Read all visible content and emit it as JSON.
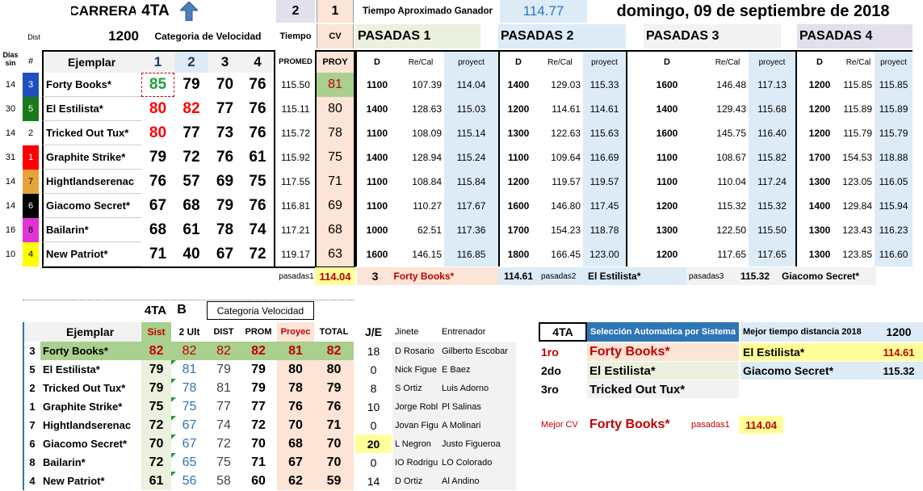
{
  "header": {
    "carrera": "CARRERA",
    "race": "4TA",
    "n2": "2",
    "n1": "1",
    "tiempo_label": "Tiempo Aproximado Ganador",
    "tiempo_value": "114.77",
    "date": "domingo, 09 de septiembre de 2018",
    "dist_label": "Dist",
    "dist_value": "1200",
    "cat_label": "Categoria de Velocidad",
    "tiempo_col": "Tiempo",
    "cv": "CV",
    "pasadas1": "PASADAS 1",
    "pasadas2": "PASADAS 2",
    "pasadas3": "PASADAS 3",
    "pasadas4": "PASADAS 4"
  },
  "cols": {
    "dias": "Dias sin",
    "num": "#",
    "ejemplar": "Ejemplar",
    "c1": "1",
    "c2": "2",
    "c3": "3",
    "c4": "4",
    "promed": "PROMED",
    "proy": "PROY",
    "d": "D",
    "recal": "Re/Cal",
    "proyect": "proyect"
  },
  "colors": {
    "post1": "#1f4fbf",
    "post2": "#1a7a1a",
    "post3": "#ffffff",
    "post4": "#ff0000",
    "post5": "#000000",
    "post6": "#e6a33a",
    "post7": "#e233d6",
    "post8": "#ffff00",
    "arrow": "#4a7ebb",
    "hl_green": "#a9d08e",
    "hl_yellow": "#ffff99",
    "accent_blue": "#2e75b6"
  },
  "rows": [
    {
      "dias": "14",
      "post": "3",
      "name": "Forty Books*",
      "s1": "85",
      "s2": "79",
      "s3": "70",
      "s4": "76",
      "prom": "115.50",
      "proy": "81",
      "p1d": "1100",
      "p1r": "107.39",
      "p1p": "114.04",
      "p2d": "1400",
      "p2r": "129.03",
      "p2p": "115.33",
      "p3d": "1600",
      "p3r": "146.48",
      "p3p": "117.13",
      "p4d": "1200",
      "p4r": "115.85",
      "p4p": "115.85"
    },
    {
      "dias": "30",
      "post": "5",
      "name": "El Estilista*",
      "s1": "80",
      "s2": "82",
      "s3": "77",
      "s4": "76",
      "prom": "115.11",
      "proy": "80",
      "p1d": "1400",
      "p1r": "128.63",
      "p1p": "115.03",
      "p2d": "1200",
      "p2r": "114.61",
      "p2p": "114.61",
      "p3d": "1400",
      "p3r": "129.43",
      "p3p": "115.68",
      "p4d": "1200",
      "p4r": "115.89",
      "p4p": "115.89"
    },
    {
      "dias": "14",
      "post": "2",
      "name": "Tricked Out Tux*",
      "s1": "80",
      "s2": "77",
      "s3": "73",
      "s4": "76",
      "prom": "115.72",
      "proy": "78",
      "p1d": "1100",
      "p1r": "108.09",
      "p1p": "115.14",
      "p2d": "1300",
      "p2r": "122.63",
      "p2p": "115.63",
      "p3d": "1600",
      "p3r": "145.75",
      "p3p": "116.40",
      "p4d": "1200",
      "p4r": "115.79",
      "p4p": "115.79"
    },
    {
      "dias": "31",
      "post": "1",
      "name": "Graphite Strike*",
      "s1": "79",
      "s2": "72",
      "s3": "76",
      "s4": "61",
      "prom": "115.92",
      "proy": "75",
      "p1d": "1400",
      "p1r": "128.94",
      "p1p": "115.24",
      "p2d": "1100",
      "p2r": "109.64",
      "p2p": "116.69",
      "p3d": "1100",
      "p3r": "108.67",
      "p3p": "115.82",
      "p4d": "1700",
      "p4r": "154.53",
      "p4p": "118.88"
    },
    {
      "dias": "14",
      "post": "7",
      "name": "Hightlandserenac",
      "s1": "76",
      "s2": "57",
      "s3": "69",
      "s4": "75",
      "prom": "117.55",
      "proy": "71",
      "p1d": "1100",
      "p1r": "108.84",
      "p1p": "115.84",
      "p2d": "1200",
      "p2r": "119.57",
      "p2p": "119.57",
      "p3d": "1100",
      "p3r": "110.04",
      "p3p": "117.24",
      "p4d": "1300",
      "p4r": "123.05",
      "p4p": "116.05"
    },
    {
      "dias": "14",
      "post": "6",
      "name": "Giacomo Secret*",
      "s1": "67",
      "s2": "68",
      "s3": "79",
      "s4": "76",
      "prom": "116.81",
      "proy": "69",
      "p1d": "1100",
      "p1r": "110.27",
      "p1p": "117.67",
      "p2d": "1600",
      "p2r": "146.80",
      "p2p": "117.45",
      "p3d": "1200",
      "p3r": "115.32",
      "p3p": "115.32",
      "p4d": "1400",
      "p4r": "129.84",
      "p4p": "115.94"
    },
    {
      "dias": "16",
      "post": "8",
      "name": "Bailarin*",
      "s1": "68",
      "s2": "61",
      "s3": "78",
      "s4": "74",
      "prom": "117.21",
      "proy": "68",
      "p1d": "1000",
      "p1r": "62.51",
      "p1p": "117.36",
      "p2d": "1700",
      "p2r": "154.23",
      "p2p": "118.78",
      "p3d": "1300",
      "p3r": "122.50",
      "p3p": "115.50",
      "p4d": "1300",
      "p4r": "123.43",
      "p4p": "116.23"
    },
    {
      "dias": "10",
      "post": "4",
      "name": "New Patriot*",
      "s1": "71",
      "s2": "40",
      "s3": "67",
      "s4": "72",
      "prom": "119.17",
      "proy": "63",
      "p1d": "1600",
      "p1r": "146.15",
      "p1p": "116.85",
      "p2d": "1800",
      "p2r": "166.45",
      "p2p": "123.00",
      "p3d": "1200",
      "p3r": "117.65",
      "p3p": "117.65",
      "p4d": "1300",
      "p4r": "123.85",
      "p4p": "116.60"
    }
  ],
  "summary": {
    "pasadas1_label": "pasadas1",
    "pasadas1_val": "114.04",
    "num": "3",
    "horse1": "Forty Books*",
    "val2": "114.61",
    "pasadas2_label": "pasadas2",
    "horse2": "El Estilista*",
    "pasadas3_label": "pasadas3",
    "val3": "115.32",
    "horse3": "Giacomo Secret*"
  },
  "lower": {
    "title": "4TA",
    "b": "B",
    "cat": "Categoria Velocidad",
    "cols": {
      "ejemplar": "Ejemplar",
      "sist": "Sist",
      "ult": "2 Ult",
      "dist": "DIST",
      "prom": "PROM",
      "proyec": "Proyec",
      "total": "TOTAL",
      "je": "J/E",
      "jinete": "Jinete",
      "entrenador": "Entrenador"
    },
    "rows": [
      {
        "post": "3",
        "name": "Forty Books*",
        "sist": "82",
        "ult": "82",
        "dist": "82",
        "prom": "82",
        "proyec": "81",
        "total": "82",
        "je": "18",
        "jinete": "D Rosario",
        "entr": "Gilberto Escobar"
      },
      {
        "post": "5",
        "name": "El Estilista*",
        "sist": "79",
        "ult": "81",
        "dist": "79",
        "prom": "79",
        "proyec": "80",
        "total": "80",
        "je": "0",
        "jinete": "Nick Figue",
        "entr": "E Baez"
      },
      {
        "post": "2",
        "name": "Tricked Out Tux*",
        "sist": "79",
        "ult": "78",
        "dist": "81",
        "prom": "79",
        "proyec": "78",
        "total": "79",
        "je": "8",
        "jinete": "S Ortiz",
        "entr": "Luis Adorno"
      },
      {
        "post": "1",
        "name": "Graphite Strike*",
        "sist": "75",
        "ult": "75",
        "dist": "77",
        "prom": "77",
        "proyec": "76",
        "total": "76",
        "je": "10",
        "jinete": "Jorge Robl",
        "entr": "Pl Salinas"
      },
      {
        "post": "7",
        "name": "Hightlandserenac",
        "sist": "72",
        "ult": "67",
        "dist": "74",
        "prom": "72",
        "proyec": "70",
        "total": "71",
        "je": "0",
        "jinete": "Jovan Figu",
        "entr": "A Molinari"
      },
      {
        "post": "6",
        "name": "Giacomo Secret*",
        "sist": "70",
        "ult": "67",
        "dist": "72",
        "prom": "70",
        "proyec": "68",
        "total": "70",
        "je": "20",
        "jinete": "L Negron",
        "entr": "Justo Figueroa"
      },
      {
        "post": "8",
        "name": "Bailarin*",
        "sist": "72",
        "ult": "65",
        "dist": "75",
        "prom": "71",
        "proyec": "67",
        "total": "70",
        "je": "0",
        "jinete": "IO Rodrigu",
        "entr": "LO Colorado"
      },
      {
        "post": "4",
        "name": "New Patriot*",
        "sist": "61",
        "ult": "56",
        "dist": "58",
        "prom": "60",
        "proyec": "62",
        "total": "59",
        "je": "14",
        "jinete": "D Ortiz",
        "entr": "Al Andino"
      }
    ]
  },
  "selection": {
    "race": "4TA",
    "title": "Selección Automatica por Sistema",
    "first": "1ro",
    "first_name": "Forty Books*",
    "second": "2do",
    "second_name": "El Estilista*",
    "third": "3ro",
    "third_name": "Tricked Out Tux*",
    "mejor_cv": "Mejor CV",
    "mejor_name": "Forty Books*",
    "mejor_pasadas": "pasadas1",
    "mejor_val": "114.04"
  },
  "mejor_tiempo": {
    "label": "Mejor tiempo distancia 2018",
    "dist": "1200",
    "h1": "El Estilista*",
    "v1": "114.61",
    "h2": "Giacomo Secret*",
    "v2": "115.32"
  }
}
